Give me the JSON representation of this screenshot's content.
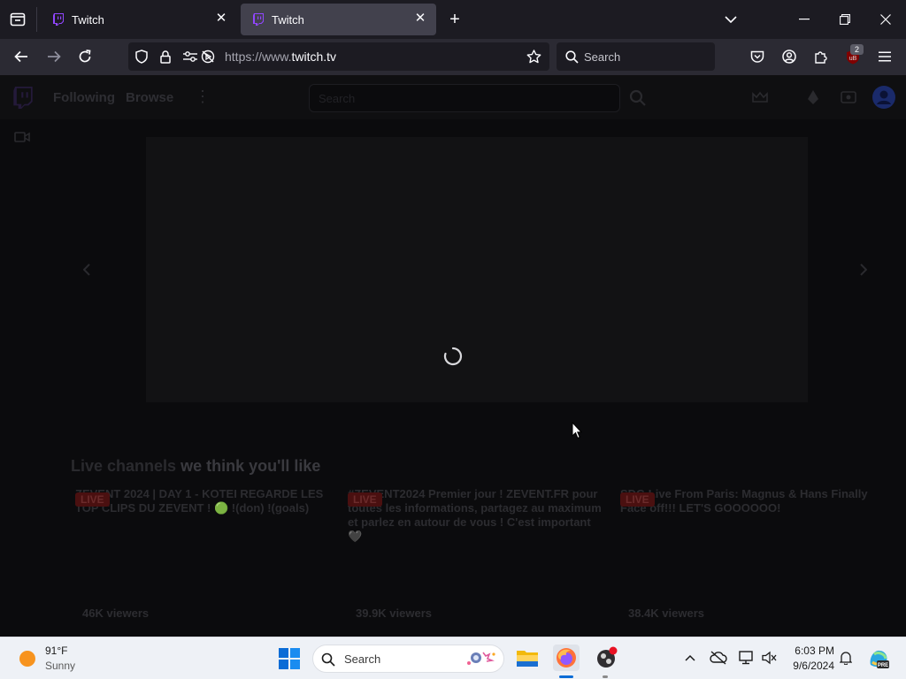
{
  "browser": {
    "tabs": [
      {
        "title": "Twitch",
        "active": false
      },
      {
        "title": "Twitch",
        "active": true
      }
    ],
    "url_prefix": "https://www.",
    "url_domain": "twitch.tv",
    "search_placeholder": "Search",
    "extension_badge": "2"
  },
  "twitch": {
    "nav": {
      "following": "Following",
      "browse": "Browse",
      "search_placeholder": "Search"
    },
    "section_title_prefix": "Live channels",
    "section_title_suffix": "we think you'll like",
    "channels": [
      {
        "title": "ZEVENT 2024 | DAY 1 - KOTEI REGARDE LES TOP CLIPS DU ZEVENT ! 🟢 !(don) !(goals)",
        "live": "LIVE",
        "viewers": "46K viewers"
      },
      {
        "title": "#ZEVENT2024 Premier jour ! ZEVENT.FR pour toutes les informations, partagez au maximum et parlez en autour de vous ! C'est important 🖤",
        "live": "LIVE",
        "viewers": "39.9K viewers"
      },
      {
        "title": "SDG Live From Paris: Magnus & Hans Finally Face off!!! LET'S GOOOOOO!",
        "live": "LIVE",
        "viewers": "38.4K viewers"
      }
    ]
  },
  "taskbar": {
    "weather_temp": "91°F",
    "weather_cond": "Sunny",
    "search_label": "Search",
    "time": "6:03 PM",
    "date": "9/6/2024"
  },
  "colors": {
    "tab_bg": "#1c1b22",
    "nav_bg": "#2b2a33",
    "twitch_purple": "#9146ff",
    "live_red": "#eb0400"
  }
}
